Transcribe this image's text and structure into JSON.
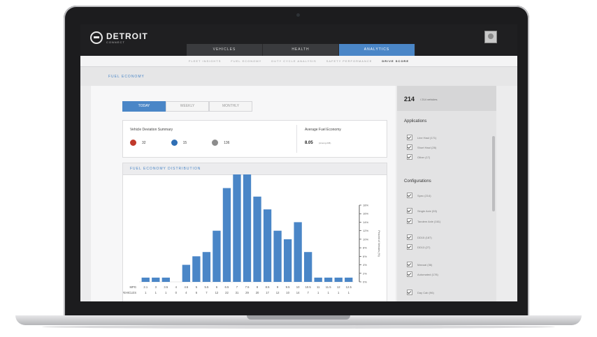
{
  "brand": {
    "name": "DETROIT",
    "sub": "CONNECT"
  },
  "tabs": [
    {
      "label": "VEHICLES",
      "active": false
    },
    {
      "label": "HEALTH",
      "active": false
    },
    {
      "label": "ANALYTICS",
      "active": true
    }
  ],
  "subnav": [
    {
      "label": "FLEET INSIGHTS",
      "active": false
    },
    {
      "label": "FUEL ECONOMY",
      "active": false
    },
    {
      "label": "DUTY CYCLE ANALYSIS",
      "active": false
    },
    {
      "label": "SAFETY PERFORMANCE",
      "active": false
    },
    {
      "label": "DRIVE SCORE",
      "active": true
    }
  ],
  "page_title": "FUEL ECONOMY",
  "segments": [
    {
      "label": "TODAY",
      "active": true
    },
    {
      "label": "WEEKLY",
      "active": false
    },
    {
      "label": "MONTHLY",
      "active": false
    }
  ],
  "summary": {
    "title": "Vehicle Deviation Summary",
    "items": [
      {
        "value": "32",
        "color": "#c0392b",
        "icon": "down-arrow-icon"
      },
      {
        "value": "15",
        "color": "#2f6fb5",
        "icon": "up-arrow-icon"
      },
      {
        "value": "136",
        "color": "#8c8c8c",
        "icon": "circle-icon"
      }
    ],
    "avg_title": "Average Fuel Economy",
    "avg_value": "8.05",
    "avg_unit": "(Among 245)"
  },
  "chart_section_title": "FUEL ECONOMY DISTRIBUTION",
  "chart_data": {
    "type": "bar",
    "categories": [
      "2.1",
      "3",
      "3.5",
      "4",
      "4.5",
      "5",
      "5.5",
      "6",
      "6.5",
      "7",
      "7.5",
      "8",
      "8.5",
      "9",
      "9.5",
      "10",
      "10.5",
      "11",
      "11.5",
      "12",
      "12.5"
    ],
    "values": [
      1,
      1,
      1,
      0,
      4,
      6,
      7,
      12,
      22,
      31,
      29,
      20,
      17,
      12,
      10,
      14,
      7,
      1,
      1,
      1,
      1
    ],
    "counts_label": "VEHICLES",
    "x_label": "MPG",
    "ylabel": "Percent of Vehicles (%)",
    "y_ticks": [
      "18%",
      "16%",
      "14%",
      "12%",
      "10%",
      "8%",
      "6%",
      "4%",
      "2%",
      "0%"
    ],
    "ylim": [
      0,
      18
    ],
    "bar_color": "#4a86c7"
  },
  "sidebar": {
    "count": "214",
    "count_label": "/ 214 vehicles",
    "applications_title": "Applications",
    "applications": [
      "Line Haul (171)",
      "Short Haul (26)",
      "Other (17)"
    ],
    "configurations_title": "Configurations",
    "configurations": [
      "Spec (214)",
      "Single Axle (53)",
      "Tandem Axle (161)",
      "DD15 (187)",
      "DD13 (27)",
      "Manual (36)",
      "Automated (178)",
      "Day Cab (96)"
    ]
  }
}
